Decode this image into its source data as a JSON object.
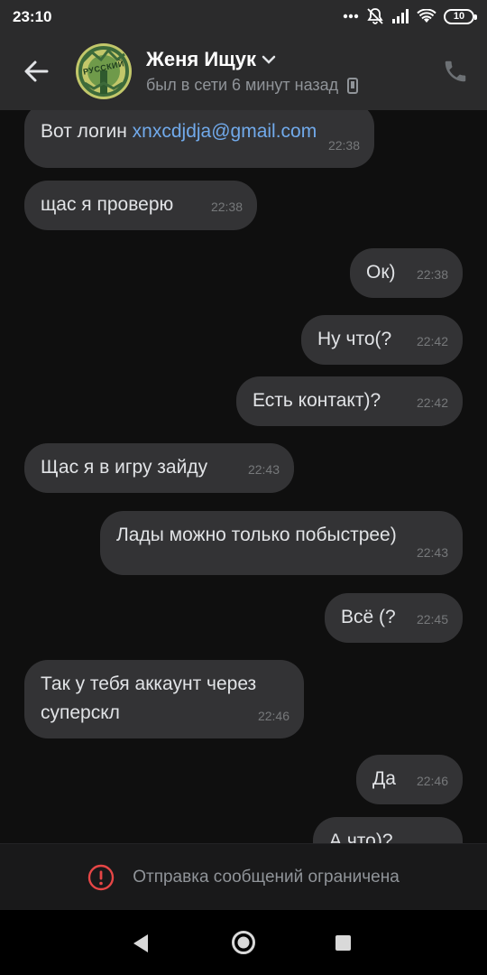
{
  "status_bar": {
    "time": "23:10",
    "battery": "10"
  },
  "header": {
    "back_icon": "arrow-left-icon",
    "avatar_text": "РУССКИЙ",
    "contact_name": "Женя Ищук",
    "last_seen": "был в сети 6 минут назад",
    "call_icon": "phone-icon"
  },
  "messages": [
    {
      "side": "in",
      "text_before": "Вот логин ",
      "link": "xnxcdjdja@gmail.com",
      "time": "22:38"
    },
    {
      "side": "in",
      "text": "щас я проверю",
      "time": "22:38"
    },
    {
      "side": "out",
      "text": "Ок)",
      "time": "22:38"
    },
    {
      "side": "out",
      "text": "Ну что(?",
      "time": "22:42"
    },
    {
      "side": "out",
      "text": "Есть контакт)?",
      "time": "22:42"
    },
    {
      "side": "in",
      "text": "Щас я в игру зайду",
      "time": "22:43"
    },
    {
      "side": "out",
      "text": "Лады можно только побыстрее)",
      "time": "22:43"
    },
    {
      "side": "out",
      "text": "Всё (?",
      "time": "22:45"
    },
    {
      "side": "in",
      "text": "Так у тебя аккаунт через\nсуперскл",
      "time": "22:46"
    },
    {
      "side": "out",
      "text": "Да",
      "time": "22:46"
    },
    {
      "side": "out",
      "text": "А что)?",
      "time": ""
    }
  ],
  "footer": {
    "restricted_text": "Отправка сообщений ограничена",
    "icon": "alert-circle-icon"
  },
  "colors": {
    "background": "#0f0f0f",
    "bubble": "#333335",
    "header": "#2b2b2c",
    "link": "#71aaeb",
    "alert": "#e64646"
  }
}
